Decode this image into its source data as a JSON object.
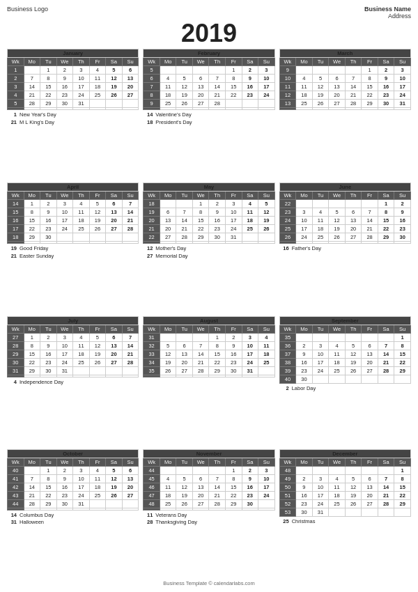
{
  "business": {
    "logo": "Business Logo",
    "name": "Business Name",
    "address": "Address"
  },
  "year": "2019",
  "footer": "Business Template © calendarlabs.com",
  "months": [
    {
      "name": "January",
      "weeks": [
        {
          "wk": "1",
          "days": [
            "",
            "",
            "1",
            "2",
            "3",
            "4",
            "5",
            "6"
          ]
        },
        {
          "wk": "2",
          "days": [
            "",
            "7",
            "8",
            "9",
            "10",
            "11",
            "12",
            "13"
          ]
        },
        {
          "wk": "3",
          "days": [
            "",
            "14",
            "15",
            "16",
            "17",
            "18",
            "19",
            "20"
          ]
        },
        {
          "wk": "4",
          "days": [
            "",
            "21",
            "22",
            "23",
            "24",
            "25",
            "26",
            "27"
          ]
        },
        {
          "wk": "5",
          "days": [
            "",
            "28",
            "29",
            "30",
            "31",
            "",
            "",
            ""
          ]
        },
        {
          "wk": "",
          "days": [
            "",
            "",
            "",
            "",
            "",
            "",
            "",
            ""
          ]
        }
      ],
      "holidays": [
        {
          "day": "1",
          "name": "New Year's Day"
        },
        {
          "day": "21",
          "name": "M L King's Day"
        }
      ]
    },
    {
      "name": "February",
      "weeks": [
        {
          "wk": "5",
          "days": [
            "",
            "",
            "",
            "",
            "",
            "1",
            "2",
            "3"
          ]
        },
        {
          "wk": "6",
          "days": [
            "",
            "4",
            "5",
            "6",
            "7",
            "8",
            "9",
            "10"
          ]
        },
        {
          "wk": "7",
          "days": [
            "",
            "11",
            "12",
            "13",
            "14",
            "15",
            "16",
            "17"
          ]
        },
        {
          "wk": "8",
          "days": [
            "",
            "18",
            "19",
            "20",
            "21",
            "22",
            "23",
            "24"
          ]
        },
        {
          "wk": "9",
          "days": [
            "",
            "25",
            "26",
            "27",
            "28",
            "",
            "",
            ""
          ]
        },
        {
          "wk": "",
          "days": [
            "",
            "",
            "",
            "",
            "",
            "",
            "",
            ""
          ]
        }
      ],
      "holidays": [
        {
          "day": "14",
          "name": "Valentine's Day"
        },
        {
          "day": "18",
          "name": "President's Day"
        }
      ]
    },
    {
      "name": "March",
      "weeks": [
        {
          "wk": "9",
          "days": [
            "",
            "",
            "",
            "",
            "",
            "1",
            "2",
            "3"
          ]
        },
        {
          "wk": "10",
          "days": [
            "",
            "4",
            "5",
            "6",
            "7",
            "8",
            "9",
            "10"
          ]
        },
        {
          "wk": "11",
          "days": [
            "",
            "11",
            "12",
            "13",
            "14",
            "15",
            "16",
            "17"
          ]
        },
        {
          "wk": "12",
          "days": [
            "",
            "18",
            "19",
            "20",
            "21",
            "22",
            "23",
            "24"
          ]
        },
        {
          "wk": "13",
          "days": [
            "",
            "25",
            "26",
            "27",
            "28",
            "29",
            "30",
            "31"
          ]
        },
        {
          "wk": "",
          "days": [
            "",
            "",
            "",
            "",
            "",
            "",
            "",
            ""
          ]
        }
      ],
      "holidays": []
    },
    {
      "name": "April",
      "weeks": [
        {
          "wk": "14",
          "days": [
            "",
            "1",
            "2",
            "3",
            "4",
            "5",
            "6",
            "7"
          ]
        },
        {
          "wk": "15",
          "days": [
            "",
            "8",
            "9",
            "10",
            "11",
            "12",
            "13",
            "14"
          ]
        },
        {
          "wk": "16",
          "days": [
            "",
            "15",
            "16",
            "17",
            "18",
            "19",
            "20",
            "21"
          ]
        },
        {
          "wk": "17",
          "days": [
            "",
            "22",
            "23",
            "24",
            "25",
            "26",
            "27",
            "28"
          ]
        },
        {
          "wk": "18",
          "days": [
            "",
            "29",
            "30",
            "",
            "",
            "",
            "",
            ""
          ]
        },
        {
          "wk": "",
          "days": [
            "",
            "",
            "",
            "",
            "",
            "",
            "",
            ""
          ]
        }
      ],
      "holidays": [
        {
          "day": "19",
          "name": "Good Friday"
        },
        {
          "day": "21",
          "name": "Easter Sunday"
        }
      ]
    },
    {
      "name": "May",
      "weeks": [
        {
          "wk": "18",
          "days": [
            "",
            "",
            "",
            "1",
            "2",
            "3",
            "4",
            "5"
          ]
        },
        {
          "wk": "19",
          "days": [
            "",
            "6",
            "7",
            "8",
            "9",
            "10",
            "11",
            "12"
          ]
        },
        {
          "wk": "20",
          "days": [
            "",
            "13",
            "14",
            "15",
            "16",
            "17",
            "18",
            "19"
          ]
        },
        {
          "wk": "21",
          "days": [
            "",
            "20",
            "21",
            "22",
            "23",
            "24",
            "25",
            "26"
          ]
        },
        {
          "wk": "22",
          "days": [
            "",
            "27",
            "28",
            "29",
            "30",
            "31",
            "",
            ""
          ]
        },
        {
          "wk": "",
          "days": [
            "",
            "",
            "",
            "",
            "",
            "",
            "",
            ""
          ]
        }
      ],
      "holidays": [
        {
          "day": "12",
          "name": "Mother's Day"
        },
        {
          "day": "27",
          "name": "Memorial Day"
        }
      ]
    },
    {
      "name": "June",
      "weeks": [
        {
          "wk": "22",
          "days": [
            "",
            "",
            "",
            "",
            "",
            "",
            "1",
            "2"
          ]
        },
        {
          "wk": "23",
          "days": [
            "",
            "3",
            "4",
            "5",
            "6",
            "7",
            "8",
            "9"
          ]
        },
        {
          "wk": "24",
          "days": [
            "",
            "10",
            "11",
            "12",
            "13",
            "14",
            "15",
            "16"
          ]
        },
        {
          "wk": "25",
          "days": [
            "",
            "17",
            "18",
            "19",
            "20",
            "21",
            "22",
            "23"
          ]
        },
        {
          "wk": "26",
          "days": [
            "",
            "24",
            "25",
            "26",
            "27",
            "28",
            "29",
            "30"
          ]
        },
        {
          "wk": "",
          "days": [
            "",
            "",
            "",
            "",
            "",
            "",
            "",
            ""
          ]
        }
      ],
      "holidays": [
        {
          "day": "16",
          "name": "Father's Day"
        }
      ]
    },
    {
      "name": "July",
      "weeks": [
        {
          "wk": "27",
          "days": [
            "",
            "1",
            "2",
            "3",
            "4",
            "5",
            "6",
            "7"
          ]
        },
        {
          "wk": "28",
          "days": [
            "",
            "8",
            "9",
            "10",
            "11",
            "12",
            "13",
            "14"
          ]
        },
        {
          "wk": "29",
          "days": [
            "",
            "15",
            "16",
            "17",
            "18",
            "19",
            "20",
            "21"
          ]
        },
        {
          "wk": "30",
          "days": [
            "",
            "22",
            "23",
            "24",
            "25",
            "26",
            "27",
            "28"
          ]
        },
        {
          "wk": "31",
          "days": [
            "",
            "29",
            "30",
            "31",
            "",
            "",
            "",
            ""
          ]
        },
        {
          "wk": "",
          "days": [
            "",
            "",
            "",
            "",
            "",
            "",
            "",
            ""
          ]
        }
      ],
      "holidays": [
        {
          "day": "4",
          "name": "Independence Day"
        }
      ]
    },
    {
      "name": "August",
      "weeks": [
        {
          "wk": "31",
          "days": [
            "",
            "",
            "",
            "",
            "1",
            "2",
            "3",
            "4"
          ]
        },
        {
          "wk": "32",
          "days": [
            "",
            "5",
            "6",
            "7",
            "8",
            "9",
            "10",
            "11"
          ]
        },
        {
          "wk": "33",
          "days": [
            "",
            "12",
            "13",
            "14",
            "15",
            "16",
            "17",
            "18"
          ]
        },
        {
          "wk": "34",
          "days": [
            "",
            "19",
            "20",
            "21",
            "22",
            "23",
            "24",
            "25"
          ]
        },
        {
          "wk": "35",
          "days": [
            "",
            "26",
            "27",
            "28",
            "29",
            "30",
            "31",
            ""
          ]
        },
        {
          "wk": "",
          "days": [
            "",
            "",
            "",
            "",
            "",
            "",
            "",
            ""
          ]
        }
      ],
      "holidays": []
    },
    {
      "name": "September",
      "weeks": [
        {
          "wk": "35",
          "days": [
            "",
            "",
            "",
            "",
            "",
            "",
            "",
            "1"
          ]
        },
        {
          "wk": "36",
          "days": [
            "",
            "2",
            "3",
            "4",
            "5",
            "6",
            "7",
            "8"
          ]
        },
        {
          "wk": "37",
          "days": [
            "",
            "9",
            "10",
            "11",
            "12",
            "13",
            "14",
            "15"
          ]
        },
        {
          "wk": "38",
          "days": [
            "",
            "16",
            "17",
            "18",
            "19",
            "20",
            "21",
            "22"
          ]
        },
        {
          "wk": "39",
          "days": [
            "",
            "23",
            "24",
            "25",
            "26",
            "27",
            "28",
            "29"
          ]
        },
        {
          "wk": "40",
          "days": [
            "",
            "30",
            "",
            "",
            "",
            "",
            "",
            ""
          ]
        }
      ],
      "holidays": [
        {
          "day": "2",
          "name": "Labor Day"
        }
      ]
    },
    {
      "name": "October",
      "weeks": [
        {
          "wk": "40",
          "days": [
            "",
            "",
            "1",
            "2",
            "3",
            "4",
            "5",
            "6"
          ]
        },
        {
          "wk": "41",
          "days": [
            "",
            "7",
            "8",
            "9",
            "10",
            "11",
            "12",
            "13"
          ]
        },
        {
          "wk": "42",
          "days": [
            "",
            "14",
            "15",
            "16",
            "17",
            "18",
            "19",
            "20"
          ]
        },
        {
          "wk": "43",
          "days": [
            "",
            "21",
            "22",
            "23",
            "24",
            "25",
            "26",
            "27"
          ]
        },
        {
          "wk": "44",
          "days": [
            "",
            "28",
            "29",
            "30",
            "31",
            "",
            "",
            ""
          ]
        },
        {
          "wk": "",
          "days": [
            "",
            "",
            "",
            "",
            "",
            "",
            "",
            ""
          ]
        }
      ],
      "holidays": [
        {
          "day": "14",
          "name": "Columbus Day"
        },
        {
          "day": "31",
          "name": "Halloween"
        }
      ]
    },
    {
      "name": "November",
      "weeks": [
        {
          "wk": "44",
          "days": [
            "",
            "",
            "",
            "",
            "",
            "1",
            "2",
            "3"
          ]
        },
        {
          "wk": "45",
          "days": [
            "",
            "4",
            "5",
            "6",
            "7",
            "8",
            "9",
            "10"
          ]
        },
        {
          "wk": "46",
          "days": [
            "",
            "11",
            "12",
            "13",
            "14",
            "15",
            "16",
            "17"
          ]
        },
        {
          "wk": "47",
          "days": [
            "",
            "18",
            "19",
            "20",
            "21",
            "22",
            "23",
            "24"
          ]
        },
        {
          "wk": "48",
          "days": [
            "",
            "25",
            "26",
            "27",
            "28",
            "29",
            "30",
            ""
          ]
        },
        {
          "wk": "",
          "days": [
            "",
            "",
            "",
            "",
            "",
            "",
            "",
            ""
          ]
        }
      ],
      "holidays": [
        {
          "day": "11",
          "name": "Veterans Day"
        },
        {
          "day": "28",
          "name": "Thanksgiving Day"
        }
      ]
    },
    {
      "name": "December",
      "weeks": [
        {
          "wk": "48",
          "days": [
            "",
            "",
            "",
            "",
            "",
            "",
            "",
            "1"
          ]
        },
        {
          "wk": "49",
          "days": [
            "",
            "2",
            "3",
            "4",
            "5",
            "6",
            "7",
            "8"
          ]
        },
        {
          "wk": "50",
          "days": [
            "",
            "9",
            "10",
            "11",
            "12",
            "13",
            "14",
            "15"
          ]
        },
        {
          "wk": "51",
          "days": [
            "",
            "16",
            "17",
            "18",
            "19",
            "20",
            "21",
            "22"
          ]
        },
        {
          "wk": "52",
          "days": [
            "",
            "23",
            "24",
            "25",
            "26",
            "27",
            "28",
            "29"
          ]
        },
        {
          "wk": "53",
          "days": [
            "",
            "30",
            "31",
            "",
            "",
            "",
            "",
            ""
          ]
        }
      ],
      "holidays": [
        {
          "day": "25",
          "name": "Christmas"
        }
      ]
    }
  ],
  "dayHeaders": [
    "Wk",
    "Mo",
    "Tu",
    "We",
    "Th",
    "Fr",
    "Sa",
    "Su"
  ]
}
